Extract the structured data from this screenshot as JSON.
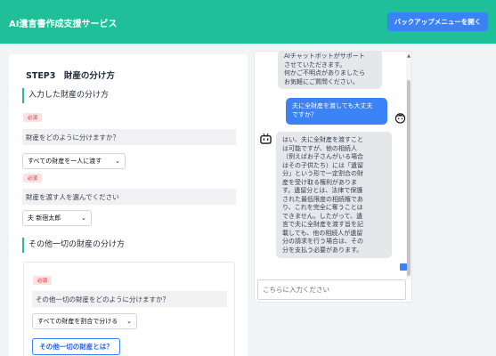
{
  "header": {
    "title": "AI遺言書作成支援サービス",
    "backup_button": "バックアップメニューを開く"
  },
  "step": {
    "title": "STEP3　財産の分け方",
    "section1": {
      "heading": "入力した財産の分け方",
      "required_label": "必須",
      "question1": "財産をどのように分けますか？",
      "select1_value": "すべての財産を一人に渡す",
      "question2": "財産を渡す人を選んでください",
      "select2_value": "夫 新宿太郎"
    },
    "section2": {
      "heading": "その他一切の財産の分け方",
      "required_label": "必須",
      "question": "その他一切の財産をどのように分けますか？",
      "select_value": "すべての財産を割合で分ける",
      "info_button": "その他一切の財産とは？"
    }
  },
  "chat": {
    "messages": [
      {
        "role": "bot",
        "lines": [
          "AIチャットボットがサポート",
          "させていただきます。",
          "何かご不明点がありましたら",
          "お気軽にご質問ください。"
        ]
      },
      {
        "role": "user",
        "lines": [
          "夫に全財産を渡しても大丈夫",
          "ですか？"
        ]
      },
      {
        "role": "bot",
        "lines": [
          "はい、夫に全財産を渡すこと",
          "は可能ですが、他の相続人",
          "（例えばお子さんがいる場合",
          "はその子供たち）には「遺留",
          "分」という形で一定割合の財",
          "産を受け取る権利がありま",
          "す。遺留分とは、法律で保護",
          "された最低限度の相続権であ",
          "り、これを完全に奪うことは",
          "できません。したがって、遺",
          "言で夫に全財産を渡す旨を記",
          "載しても、他の相続人が遺留",
          "分の請求を行う場合は、その",
          "分を支払う必要があります。"
        ]
      }
    ],
    "input_placeholder": "こちらに入力ください"
  },
  "colors": {
    "header": "#1fbf9a",
    "primary": "#3b82f6",
    "required": "#dc2626"
  }
}
